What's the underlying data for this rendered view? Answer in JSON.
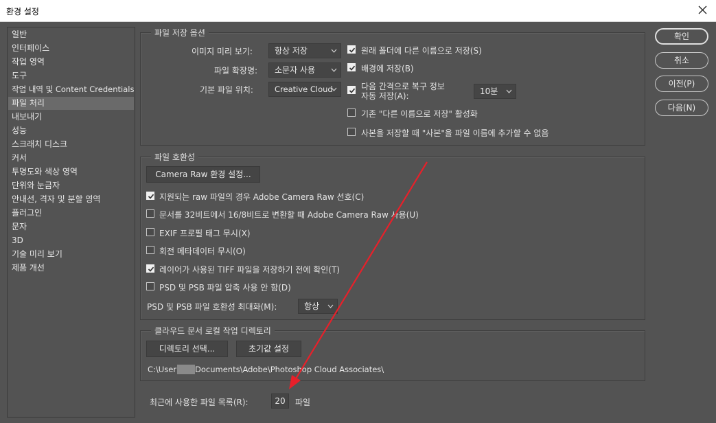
{
  "window": {
    "title": "환경 설정"
  },
  "sidebar": {
    "items": [
      {
        "label": "일반"
      },
      {
        "label": "인터페이스"
      },
      {
        "label": "작업 영역"
      },
      {
        "label": "도구"
      },
      {
        "label": "작업 내역 및 Content Credentials"
      },
      {
        "label": "파일 처리",
        "selected": true
      },
      {
        "label": "내보내기"
      },
      {
        "label": "성능"
      },
      {
        "label": "스크래치 디스크"
      },
      {
        "label": "커서"
      },
      {
        "label": "투명도와 색상 영역"
      },
      {
        "label": "단위와 눈금자"
      },
      {
        "label": "안내선, 격자 및 분할 영역"
      },
      {
        "label": "플러그인"
      },
      {
        "label": "문자"
      },
      {
        "label": "3D"
      },
      {
        "label": "기술 미리 보기"
      },
      {
        "label": "제품 개선"
      }
    ]
  },
  "save_options": {
    "legend": "파일 저장 옵션",
    "image_preview_label": "이미지 미리 보기:",
    "image_preview_value": "항상 저장",
    "extension_label": "파일 확장명:",
    "extension_value": "소문자 사용",
    "default_location_label": "기본 파일 위치:",
    "default_location_value": "Creative Cloud",
    "save_as_original_folder": {
      "label": "원래 폴더에 다른 이름으로 저장(S)",
      "checked": true
    },
    "save_in_background": {
      "label": "배경에 저장(B)",
      "checked": true
    },
    "auto_save": {
      "label_line1": "다음 간격으로 복구 정보",
      "label_line2": "자동 저장(A):",
      "checked": true
    },
    "auto_save_interval": "10분",
    "legacy_save_as": {
      "label": "기존 \"다른 이름으로 저장\" 활성화",
      "checked": false
    },
    "no_copy_suffix": {
      "label": "사본을 저장할 때 \"사본\"을 파일 이름에 추가할 수 없음",
      "checked": false
    }
  },
  "compatibility": {
    "legend": "파일 호환성",
    "camera_raw_button": "Camera Raw 환경 설정...",
    "options": [
      {
        "label": "지원되는 raw 파일의 경우 Adobe Camera Raw 선호(C)",
        "checked": true
      },
      {
        "label": "문서를 32비트에서 16/8비트로 변환할 때 Adobe Camera Raw 사용(U)",
        "checked": false
      },
      {
        "label": "EXIF 프로필 태그 무시(X)",
        "checked": false
      },
      {
        "label": "회전 메타데이터 무시(O)",
        "checked": false
      },
      {
        "label": "레이어가 사용된 TIFF 파일을 저장하기 전에 확인(T)",
        "checked": true
      },
      {
        "label": "PSD 및 PSB 파일 압축 사용 안 함(D)",
        "checked": false
      }
    ],
    "maximize_label": "PSD 및 PSB 파일 호환성 최대화(M):",
    "maximize_value": "항상"
  },
  "cloud": {
    "legend": "클라우드 문서 로컬 작업 디렉토리",
    "choose_button": "디렉토리 선택...",
    "reset_button": "초기값 설정",
    "path_prefix": "C:\\User",
    "path_suffix": "Documents\\Adobe\\Photoshop Cloud Associates\\"
  },
  "recent": {
    "label": "최근에 사용한 파일 목록(R):",
    "value": "20",
    "unit": "파일"
  },
  "buttons": {
    "ok": "확인",
    "cancel": "취소",
    "prev": "이전(P)",
    "next": "다음(N)"
  },
  "colors": {
    "background": "#535353",
    "annotation_arrow": "#e8202a"
  },
  "icons": {
    "close": "close-icon",
    "dropdown": "chevron-down-icon",
    "checkbox_checked": "checkmark-icon"
  }
}
